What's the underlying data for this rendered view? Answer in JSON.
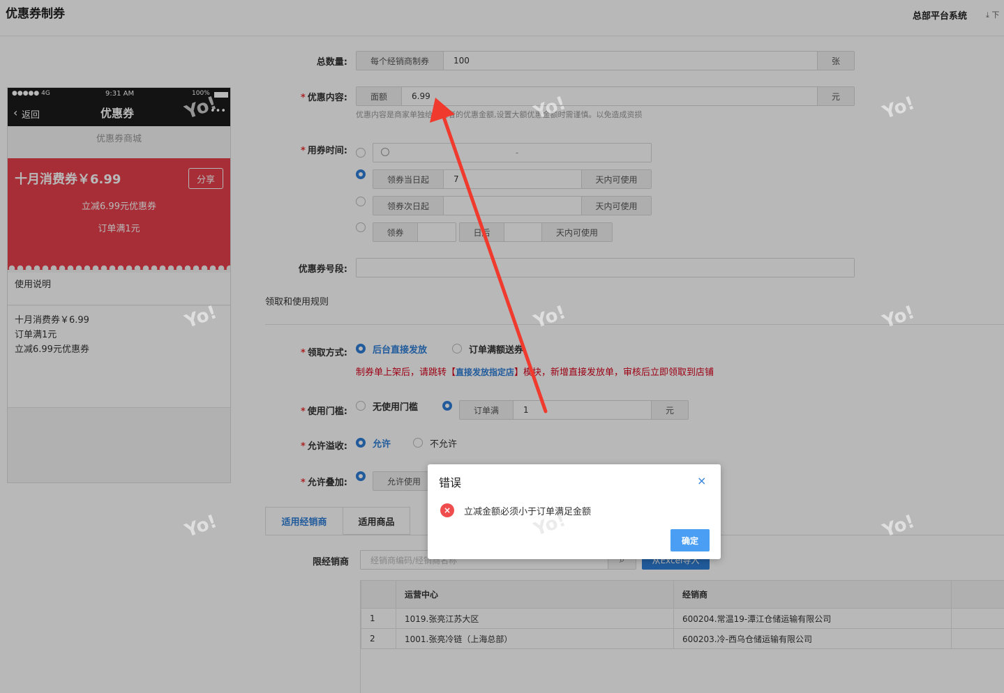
{
  "header": {
    "title": "优惠券制券",
    "system": "总部平台系统",
    "download": "⤓ 下"
  },
  "form": {
    "total": {
      "label": "总数量:",
      "prefix": "每个经销商制券",
      "value": "100",
      "suffix": "张"
    },
    "content": {
      "label": "优惠内容:",
      "prefix": "面额",
      "value": "6.99",
      "suffix": "元",
      "hint": "优惠内容是商家单独给消费者的优惠金额,设置大额优惠金额时需谨慎。以免造成资损"
    },
    "time": {
      "label": "用券时间:",
      "range_sep": "-",
      "opt2_prefix": "领券当日起",
      "opt2_value": "7",
      "opt2_suffix": "天内可使用",
      "opt3_prefix": "领券次日起",
      "opt3_suffix": "天内可使用",
      "opt4_prefix": "领券",
      "opt4_mid": "日后",
      "opt4_suffix": "天内可使用"
    },
    "segment": {
      "label": "优惠券号段:"
    },
    "section_title": "领取和使用规则",
    "receive": {
      "label": "领取方式:",
      "opt1": "后台直接发放",
      "opt2": "订单满额送券"
    },
    "notice": {
      "part1": "制券单上架后，请跳转【",
      "link": "直接发放指定店",
      "part2": "】模块，新增直接发放单，审核后立即领取到店铺"
    },
    "threshold": {
      "label": "使用门槛:",
      "opt1": "无使用门槛",
      "prefix": "订单满",
      "value": "1",
      "suffix": "元"
    },
    "overflow": {
      "label": "允许溢收:",
      "opt1": "允许",
      "opt2": "不允许"
    },
    "stack": {
      "label": "允许叠加:",
      "opt1": "允许使用"
    }
  },
  "phone": {
    "carrier": "●●●●● 4G",
    "time": "9:31 AM",
    "battery": "100%",
    "back": "返回",
    "title": "优惠券",
    "more": "•••",
    "mall": "优惠券商城",
    "coupon_name": "十月消费券￥6.99",
    "share": "分享",
    "coupon_desc": "立减6.99元优惠券",
    "coupon_cond": "订单满1元",
    "usage_title": "使用说明",
    "usage_lines": [
      "十月消费券￥6.99",
      "订单满1元",
      "立减6.99元优惠券"
    ]
  },
  "tabs": [
    "适用经销商",
    "适用商品"
  ],
  "dealer": {
    "label": "限经销商",
    "placeholder": "经销商编码/经销商名称",
    "import": "从Excel导入"
  },
  "table": {
    "headers": [
      "",
      "运营中心",
      "经销商",
      ""
    ],
    "rows": [
      [
        "1",
        "1019.张亮江苏大区",
        "600204.常温19-潭江仓储运输有限公司"
      ],
      [
        "2",
        "1001.张亮冷链（上海总部）",
        "600203.冷-西乌仓储运输有限公司"
      ]
    ]
  },
  "watermark": "Yo!",
  "modal": {
    "title": "错误",
    "close": "×",
    "icon": "×",
    "message": "立减金额必须小于订单满足金额",
    "ok": "确定"
  },
  "colors": {
    "accent": "#2f7fd8",
    "coupon": "#e8404d",
    "notice": "#d9001b",
    "arrow": "#f03a2e",
    "ok": "#4a9ff5"
  }
}
